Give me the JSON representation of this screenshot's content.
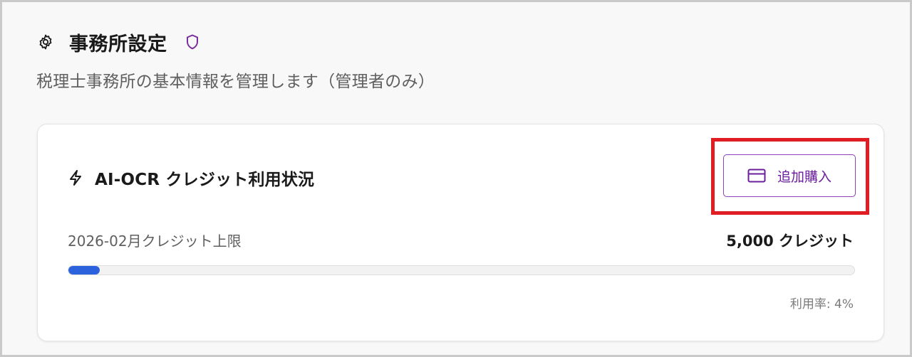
{
  "page": {
    "title": "事務所設定",
    "subtitle": "税理士事務所の基本情報を管理します（管理者のみ）",
    "icons": {
      "settings": "gear-icon",
      "admin": "shield-icon"
    },
    "accent_color": "#7b2d9e"
  },
  "credit_card": {
    "title": "AI-OCR クレジット利用状況",
    "title_icon": "lightning-icon",
    "buy_button": {
      "label": "追加購入",
      "icon": "credit-card-icon"
    },
    "usage_label": "2026-02月クレジット上限",
    "limit_text": "5,000 クレジット",
    "usage_fraction": 0.04,
    "usage_rate_text": "利用率: 4%",
    "progress_color": "#2c63dc"
  }
}
